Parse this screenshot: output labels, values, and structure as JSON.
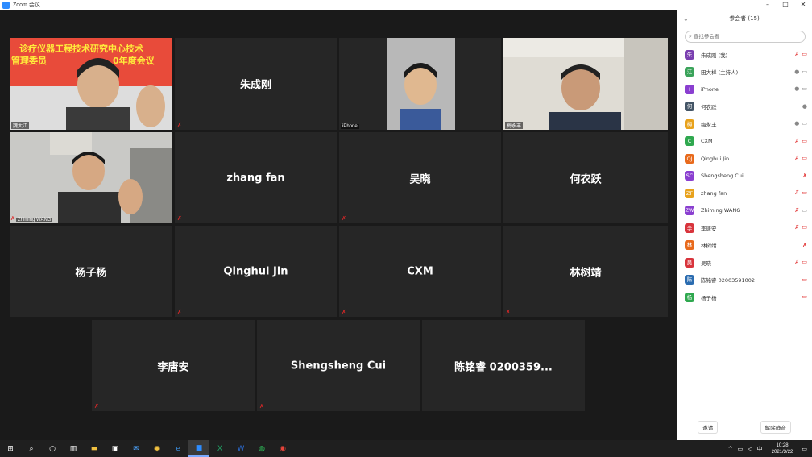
{
  "window": {
    "title": "Zoom 会议",
    "btn_min": "–",
    "btn_max": "□",
    "btn_close": "✕"
  },
  "colors": {
    "active_speaker": "#b9e34a",
    "mic_muted": "#e02828",
    "panel_bg": "#ffffff",
    "tile_bg": "#262626"
  },
  "gallery": {
    "t1": {
      "label": "魏大江"
    },
    "t2": {
      "name": "朱成刚"
    },
    "t3": {
      "label": "iPhone"
    },
    "t4": {
      "label": "梅永丰"
    },
    "t5": {
      "label": "Zhiming WANG"
    },
    "t6": {
      "name": "zhang fan"
    },
    "t7": {
      "name": "吴晓"
    },
    "t8": {
      "name": "何农跃"
    },
    "t9": {
      "name": "杨子杨"
    },
    "t10": {
      "name": "Qinghui Jin"
    },
    "t11": {
      "name": "CXM"
    },
    "t12": {
      "name": "林树靖"
    },
    "t13": {
      "name": "李唐安"
    },
    "t14": {
      "name": "Shengsheng Cui"
    },
    "t15": {
      "name": "陈铭睿 0200359..."
    }
  },
  "banner_lines": [
    "诊疗仪器工程技术研究中心技术",
    "管理委员",
    "0年度会议"
  ],
  "participants_panel": {
    "title": "参会者 (15)",
    "search_placeholder": "查找参会者",
    "items": [
      {
        "initial": "朱",
        "color": "#7a3fb0",
        "name": "朱成刚 (我)",
        "mic": "muted",
        "video": "off"
      },
      {
        "initial": "江",
        "color": "#3aa35a",
        "name": "田大样 (主持人)",
        "mic": "on",
        "video": "on"
      },
      {
        "initial": "I",
        "color": "#8a3fd0",
        "name": "iPhone",
        "mic": "on",
        "video": "on"
      },
      {
        "initial": "何",
        "color": "#445566",
        "name": "何农跃",
        "mic": "on",
        "video": ""
      },
      {
        "initial": "梅",
        "color": "#e8a21c",
        "name": "梅永丰",
        "mic": "on",
        "video": "on"
      },
      {
        "initial": "C",
        "color": "#2fa84f",
        "name": "CXM",
        "mic": "muted",
        "video": "off"
      },
      {
        "initial": "QJ",
        "color": "#e86a1c",
        "name": "Qinghui Jin",
        "mic": "muted",
        "video": "off"
      },
      {
        "initial": "SC",
        "color": "#8a3fd0",
        "name": "Shengsheng Cui",
        "mic": "muted",
        "video": ""
      },
      {
        "initial": "ZF",
        "color": "#e8a21c",
        "name": "zhang fan",
        "mic": "muted",
        "video": "off"
      },
      {
        "initial": "ZW",
        "color": "#8a3fd0",
        "name": "Zhiming WANG",
        "mic": "muted",
        "video": "on"
      },
      {
        "initial": "李",
        "color": "#d8343c",
        "name": "李唐安",
        "mic": "muted",
        "video": "off"
      },
      {
        "initial": "林",
        "color": "#e86a1c",
        "name": "林树靖",
        "mic": "muted",
        "video": ""
      },
      {
        "initial": "吴",
        "color": "#d8343c",
        "name": "吴晓",
        "mic": "muted",
        "video": "off"
      },
      {
        "initial": "陈",
        "color": "#2b6cb0",
        "name": "陈铭睿 02003591002",
        "mic": "",
        "video": "off"
      },
      {
        "initial": "杨",
        "color": "#2fa84f",
        "name": "杨子杨",
        "mic": "",
        "video": "off"
      }
    ],
    "footer": {
      "invite": "邀请",
      "mute_all": "解除静音"
    }
  },
  "taskbar": {
    "clock_time": "10:28",
    "clock_date": "2021/3/22",
    "apps": [
      "start-icon",
      "search-icon",
      "cortana-icon",
      "task-view-icon",
      "file-explorer-icon",
      "store-icon",
      "mail-icon",
      "chrome-icon",
      "edge-icon",
      "zoom-icon",
      "excel-icon",
      "word-icon",
      "wechat-icon",
      "chrome2-icon"
    ]
  }
}
